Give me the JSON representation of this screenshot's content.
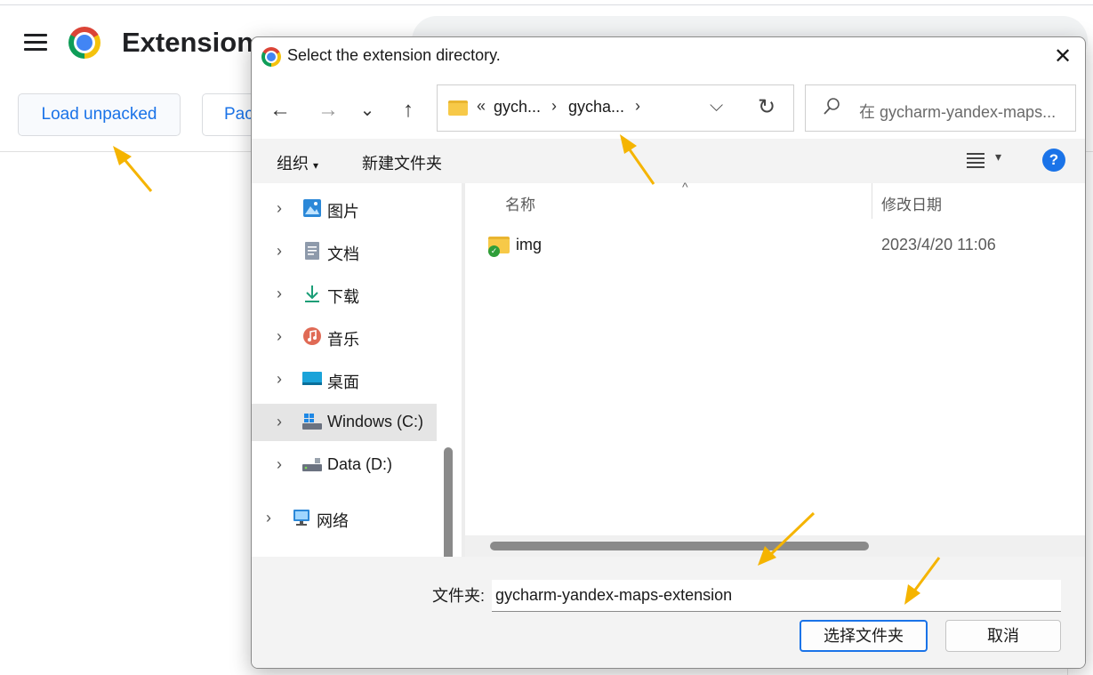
{
  "extensions_page": {
    "title": "Extension",
    "load_unpacked_label": "Load unpacked",
    "pack_label": "Pac"
  },
  "dialog": {
    "title": "Select the extension directory.",
    "close_glyph": "✕",
    "nav": {
      "back_glyph": "←",
      "forward_glyph": "→",
      "recent_glyph": "⌄",
      "up_glyph": "↑"
    },
    "address": {
      "overflow": "«",
      "crumbs": [
        "gych...",
        "gycha..."
      ],
      "separator": "›"
    },
    "search": {
      "placeholder": "在 gycharm-yandex-maps..."
    },
    "command_bar": {
      "organize_label": "组织",
      "organize_dropdown": "▾",
      "new_folder_label": "新建文件夹",
      "help_label": "?"
    },
    "nav_pane": {
      "items": [
        {
          "label": "图片",
          "icon": "pictures-icon"
        },
        {
          "label": "文档",
          "icon": "documents-icon"
        },
        {
          "label": "下载",
          "icon": "download-icon"
        },
        {
          "label": "音乐",
          "icon": "music-icon"
        },
        {
          "label": "桌面",
          "icon": "desktop-icon"
        },
        {
          "label": "Windows (C:)",
          "icon": "drive-c-icon",
          "selected": true
        },
        {
          "label": "Data (D:)",
          "icon": "drive-d-icon"
        },
        {
          "label": "网络",
          "icon": "network-icon"
        }
      ]
    },
    "file_list": {
      "columns": {
        "name": "名称",
        "modified": "修改日期"
      },
      "rows": [
        {
          "name": "img",
          "modified": "2023/4/20 11:06"
        }
      ]
    },
    "footer": {
      "folder_label": "文件夹:",
      "folder_value": "gycharm-yandex-maps-extension",
      "select_button": "选择文件夹",
      "cancel_button": "取消"
    }
  },
  "colors": {
    "accent": "#1a73e8",
    "annotation_arrow": "#f5b400"
  }
}
